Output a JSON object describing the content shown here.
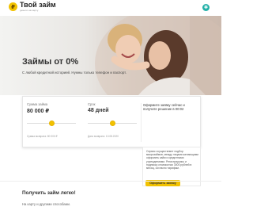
{
  "header": {
    "logo_text": "Твой займ",
    "logo_tagline": "деньги на карту",
    "menu_icon": "swirl-icon"
  },
  "hero": {
    "title": "Займы от 0%",
    "subtitle": "С любой кредитной историей. Нужны только телефон и паспорт."
  },
  "calculator": {
    "amount_label": "Сумма займа",
    "amount_value": "80 000 ₽",
    "amount_note": "Сумма возврата: 80 000 ₽",
    "term_label": "Срок",
    "term_value": "48 дней",
    "term_note": "Дата возврата: 10.08.2020",
    "result_text": "Оформите заявку сейчас и получите решение в 00:02",
    "amount_slider_level": 0.5,
    "term_slider_level": 0.5
  },
  "side_box": {
    "text": "Сервис осуществляет подбор микрозаймов, между лицами желающими оформить займ и кредитными учреждениями. Регистрируясь и подписку стоимостью 3000 рублей в месяц, согласно тарифам.",
    "button_label": "Оформить заявку"
  },
  "bottom": {
    "title": "Получить займ легко!",
    "subtitle": "На карту и другими способами."
  },
  "colors": {
    "accent": "#f2c200",
    "menu_button": "#23b0a8"
  }
}
